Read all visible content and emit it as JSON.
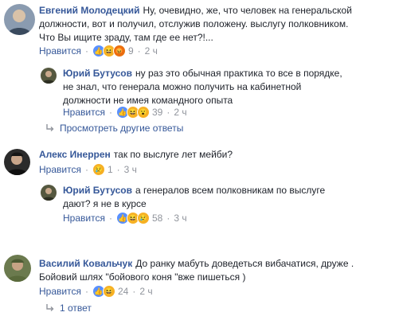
{
  "comments": [
    {
      "author": "Евгений Молодецкий",
      "text_lines": [
        "Ну, очевидно, же, что человек на генеральской",
        "должности, вот и получил, отслужив положену. выслугу полковником.",
        "Что Вы ищите зраду, там где ее нет?!..."
      ],
      "like_label": "Нравится",
      "reaction_count": "9",
      "time": "2 ч",
      "reactions": [
        "like",
        "haha",
        "angry"
      ],
      "reply": {
        "author": "Юрий Бутусов",
        "text_lines": [
          "ну раз это обычная практика то все в порядке,",
          "не знал, что генерала можно получить на кабинетной",
          "должности не имея командного опыта"
        ],
        "like_label": "Нравится",
        "reaction_count": "39",
        "time": "2 ч",
        "reactions": [
          "like",
          "haha",
          "wow"
        ]
      },
      "more_replies": "Просмотреть другие ответы"
    },
    {
      "author": "Алекс Инеррен",
      "text_lines": [
        "так по выслуге лет мейби?"
      ],
      "like_label": "Нравится",
      "reaction_count": "1",
      "time": "3 ч",
      "reactions": [
        "sad"
      ],
      "reply": {
        "author": "Юрий Бутусов",
        "text_lines": [
          "а генералов всем полковникам по выслуге",
          "дают? я не в курсе"
        ],
        "like_label": "Нравится",
        "reaction_count": "58",
        "time": "3 ч",
        "reactions": [
          "like",
          "haha",
          "sad"
        ]
      }
    },
    {
      "author": "Василий Ковальчук",
      "text_lines": [
        "До ранку мабуть доведеться вибачатися, друже .",
        "Бойовий шлях \"бойового коня \"вже пишеться )"
      ],
      "like_label": "Нравится",
      "reaction_count": "24",
      "time": "2 ч",
      "reactions": [
        "like",
        "haha"
      ],
      "replies_link": "1 ответ"
    }
  ],
  "separator_dot": "·"
}
